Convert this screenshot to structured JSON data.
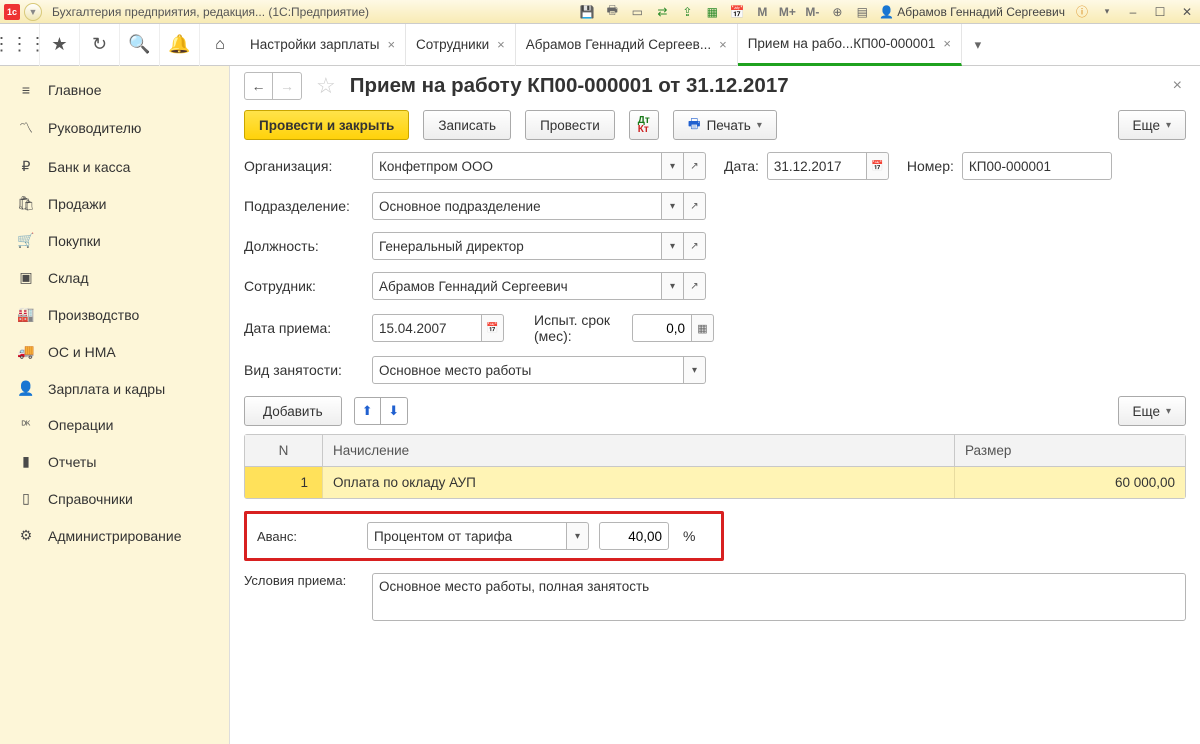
{
  "titlebar": {
    "app_title": "Бухгалтерия предприятия, редакция... (1С:Предприятие)",
    "user": "Абрамов Геннадий Сергеевич",
    "m_labels": [
      "M",
      "M+",
      "M-"
    ]
  },
  "tabs": {
    "items": [
      {
        "label": "Настройки зарплаты"
      },
      {
        "label": "Сотрудники"
      },
      {
        "label": "Абрамов Геннадий Сергеев..."
      },
      {
        "label": "Прием на рабо...КП00-000001"
      }
    ]
  },
  "sidebar": {
    "items": [
      {
        "icon": "≡",
        "label": "Главное"
      },
      {
        "icon": "〽",
        "label": "Руководителю"
      },
      {
        "icon": "₽",
        "label": "Банк и касса"
      },
      {
        "icon": "🛍",
        "label": "Продажи"
      },
      {
        "icon": "🛒",
        "label": "Покупки"
      },
      {
        "icon": "▣",
        "label": "Склад"
      },
      {
        "icon": "🏭",
        "label": "Производство"
      },
      {
        "icon": "🚚",
        "label": "ОС и НМА"
      },
      {
        "icon": "👤",
        "label": "Зарплата и кадры"
      },
      {
        "icon": "ᴰᴷ",
        "label": "Операции"
      },
      {
        "icon": "▮",
        "label": "Отчеты"
      },
      {
        "icon": "▯",
        "label": "Справочники"
      },
      {
        "icon": "⚙",
        "label": "Администрирование"
      }
    ]
  },
  "doc": {
    "title": "Прием на работу КП00-000001 от 31.12.2017",
    "actions": {
      "post_close": "Провести и закрыть",
      "save": "Записать",
      "post": "Провести",
      "print": "Печать",
      "more": "Еще"
    },
    "labels": {
      "org": "Организация:",
      "date": "Дата:",
      "number": "Номер:",
      "dept": "Подразделение:",
      "position": "Должность:",
      "employee": "Сотрудник:",
      "hire_date": "Дата приема:",
      "probation": "Испыт. срок (мес):",
      "employment": "Вид занятости:",
      "add": "Добавить",
      "avans": "Аванс:",
      "conditions": "Условия приема:"
    },
    "values": {
      "org": "Конфетпром ООО",
      "date": "31.12.2017",
      "number": "КП00-000001",
      "dept": "Основное подразделение",
      "position": "Генеральный директор",
      "employee": "Абрамов Геннадий Сергеевич",
      "hire_date": "15.04.2007",
      "probation": "0,0",
      "employment": "Основное место работы",
      "avans_type": "Процентом от тарифа",
      "avans_pct": "40,00",
      "conditions": "Основное место работы, полная занятость"
    },
    "grid": {
      "headers": {
        "n": "N",
        "name": "Начисление",
        "size": "Размер"
      },
      "rows": [
        {
          "n": "1",
          "name": "Оплата по окладу АУП",
          "size": "60 000,00"
        }
      ]
    }
  }
}
